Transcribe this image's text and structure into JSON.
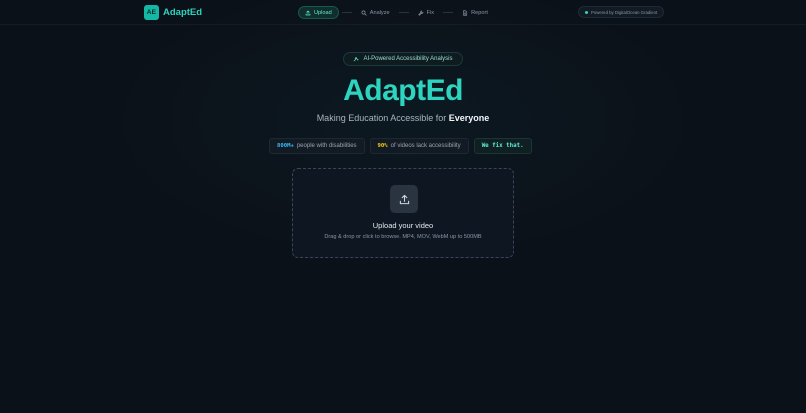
{
  "header": {
    "logo_badge": "AE",
    "logo_name": "AdaptEd",
    "steps": [
      {
        "label": "Upload",
        "icon": "upload-icon",
        "active": true
      },
      {
        "label": "Analyze",
        "icon": "search-icon",
        "active": false
      },
      {
        "label": "Fix",
        "icon": "wrench-icon",
        "active": false
      },
      {
        "label": "Report",
        "icon": "document-icon",
        "active": false
      }
    ],
    "powered_by": "Powered by DigitalOcean Gradient"
  },
  "hero": {
    "pill_label": "AI-Powered Accessibility Analysis",
    "title": "AdaptEd",
    "subtitle_prefix": "Making Education Accessible for ",
    "subtitle_emphasis": "Everyone"
  },
  "stats": [
    {
      "highlight": "800M+",
      "text": "people with disabilities",
      "color": "#38bdf8"
    },
    {
      "highlight": "90%",
      "text": "of videos lack accessibility",
      "color": "#facc15"
    },
    {
      "highlight": "We fix that.",
      "text": "",
      "color": "#5eead4"
    }
  ],
  "upload": {
    "title": "Upload your video",
    "hint": "Drag & drop or click to browse. MP4, MOV, WebM up to 500MB"
  },
  "colors": {
    "accent": "#2dd4bf",
    "background": "#0b1119"
  }
}
